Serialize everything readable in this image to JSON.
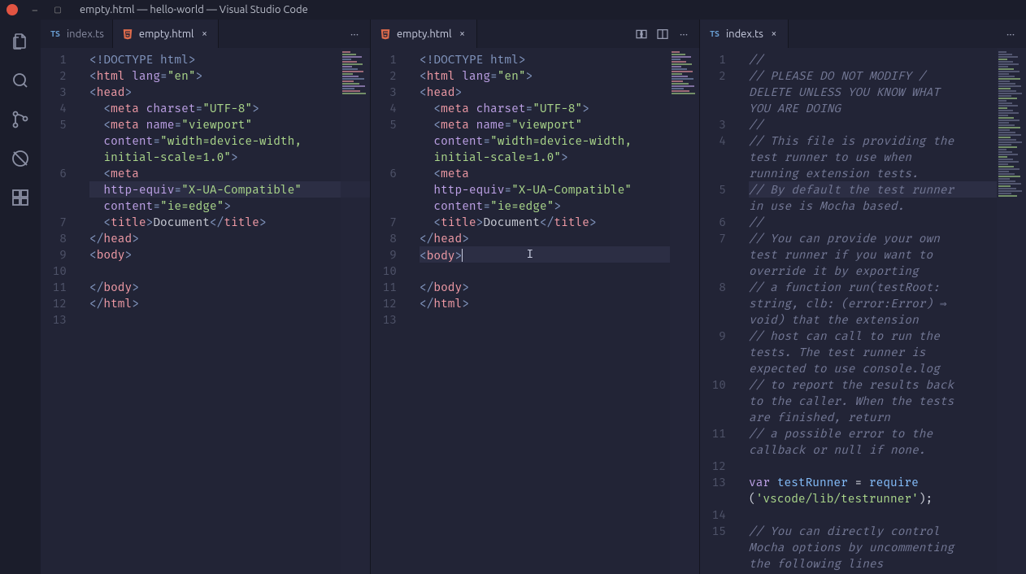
{
  "titlebar": {
    "title": "empty.html — hello-world — Visual Studio Code"
  },
  "activity": {
    "items": [
      "explorer",
      "search",
      "scm",
      "debug",
      "extensions"
    ]
  },
  "groups": [
    {
      "tabs": [
        {
          "label": "index.ts",
          "type": "ts",
          "active": false,
          "close": false
        },
        {
          "label": "empty.html",
          "type": "html",
          "active": true,
          "close": true
        }
      ],
      "actions": [
        "more"
      ],
      "lines": 13,
      "code": "html",
      "highlight_line": 6,
      "highlight_sub": true
    },
    {
      "tabs": [
        {
          "label": "empty.html",
          "type": "html",
          "active": true,
          "close": true
        }
      ],
      "actions": [
        "compare",
        "split",
        "more"
      ],
      "lines": 13,
      "code": "html",
      "cursor_line": 9,
      "highlight_line": 9
    },
    {
      "tabs": [
        {
          "label": "index.ts",
          "type": "ts",
          "active": true,
          "close": true
        }
      ],
      "actions": [
        "more"
      ],
      "lines": 15,
      "code": "ts",
      "highlight_line": 5
    }
  ],
  "html_code": {
    "1": [
      [
        "doct",
        "<!DOCTYPE html>"
      ]
    ],
    "2": [
      [
        "tg",
        "<"
      ],
      [
        "tagn",
        "html"
      ],
      [
        "txt",
        " "
      ],
      [
        "attr",
        "lang"
      ],
      [
        "tg",
        "="
      ],
      [
        "str",
        "\"en\""
      ],
      [
        "tg",
        ">"
      ]
    ],
    "3": [
      [
        "tg",
        "<"
      ],
      [
        "tagn",
        "head"
      ],
      [
        "tg",
        ">"
      ]
    ],
    "4": [
      [
        "txt",
        "  "
      ],
      [
        "tg",
        "<"
      ],
      [
        "tagn",
        "meta"
      ],
      [
        "txt",
        " "
      ],
      [
        "attr",
        "charset"
      ],
      [
        "tg",
        "="
      ],
      [
        "str",
        "\"UTF-8\""
      ],
      [
        "tg",
        ">"
      ]
    ],
    "5": [
      [
        "txt",
        "  "
      ],
      [
        "tg",
        "<"
      ],
      [
        "tagn",
        "meta"
      ],
      [
        "txt",
        " "
      ],
      [
        "attr",
        "name"
      ],
      [
        "tg",
        "="
      ],
      [
        "str",
        "\"viewport\""
      ]
    ],
    "5b": [
      [
        "txt",
        "  "
      ],
      [
        "attr",
        "content"
      ],
      [
        "tg",
        "="
      ],
      [
        "str",
        "\"width=device-width,"
      ]
    ],
    "5c": [
      [
        "txt",
        "  "
      ],
      [
        "str",
        "initial-scale=1.0\""
      ],
      [
        "tg",
        ">"
      ]
    ],
    "6": [
      [
        "txt",
        "  "
      ],
      [
        "tg",
        "<"
      ],
      [
        "tagn",
        "meta"
      ]
    ],
    "6b": [
      [
        "txt",
        "  "
      ],
      [
        "attr",
        "http-equiv"
      ],
      [
        "tg",
        "="
      ],
      [
        "str",
        "\"X-UA-Compatible\""
      ]
    ],
    "6c": [
      [
        "txt",
        "  "
      ],
      [
        "attr",
        "content"
      ],
      [
        "tg",
        "="
      ],
      [
        "str",
        "\"ie=edge\""
      ],
      [
        "tg",
        ">"
      ]
    ],
    "7": [
      [
        "txt",
        "  "
      ],
      [
        "tg",
        "<"
      ],
      [
        "tagn",
        "title"
      ],
      [
        "tg",
        ">"
      ],
      [
        "txt",
        "Document"
      ],
      [
        "tg",
        "</"
      ],
      [
        "tagn",
        "title"
      ],
      [
        "tg",
        ">"
      ]
    ],
    "8": [
      [
        "tg",
        "</"
      ],
      [
        "tagn",
        "head"
      ],
      [
        "tg",
        ">"
      ]
    ],
    "9": [
      [
        "tg",
        "<"
      ],
      [
        "tagn",
        "body"
      ],
      [
        "tg",
        ">"
      ]
    ],
    "10": [],
    "11": [
      [
        "tg",
        "</"
      ],
      [
        "tagn",
        "body"
      ],
      [
        "tg",
        ">"
      ]
    ],
    "12": [
      [
        "tg",
        "</"
      ],
      [
        "tagn",
        "html"
      ],
      [
        "tg",
        ">"
      ]
    ],
    "13": []
  },
  "ts_code": {
    "1": [
      [
        "cmt",
        "//"
      ]
    ],
    "2a": [
      [
        "cmt",
        "// PLEASE DO NOT MODIFY /"
      ]
    ],
    "2b": [
      [
        "cmt",
        "DELETE UNLESS YOU KNOW WHAT"
      ]
    ],
    "2c": [
      [
        "cmt",
        "YOU ARE DOING"
      ]
    ],
    "3": [
      [
        "cmt",
        "//"
      ]
    ],
    "4a": [
      [
        "cmt",
        "// This file is providing the"
      ]
    ],
    "4b": [
      [
        "cmt",
        "test runner to use when"
      ]
    ],
    "4c": [
      [
        "cmt",
        "running extension tests."
      ]
    ],
    "5a": [
      [
        "cmt",
        "// By default the test runner"
      ]
    ],
    "5b": [
      [
        "cmt",
        "in use is Mocha based."
      ]
    ],
    "6": [
      [
        "cmt",
        "//"
      ]
    ],
    "7a": [
      [
        "cmt",
        "// You can provide your own"
      ]
    ],
    "7b": [
      [
        "cmt",
        "test runner if you want to"
      ]
    ],
    "7c": [
      [
        "cmt",
        "override it by exporting"
      ]
    ],
    "8a": [
      [
        "cmt",
        "// a function run(testRoot:"
      ]
    ],
    "8b": [
      [
        "cmt",
        "string, clb: (error:Error) ⇒"
      ]
    ],
    "8c": [
      [
        "cmt",
        "void) that the extension"
      ]
    ],
    "9a": [
      [
        "cmt",
        "// host can call to run the"
      ]
    ],
    "9b": [
      [
        "cmt",
        "tests. The test runner is"
      ]
    ],
    "9c": [
      [
        "cmt",
        "expected to use console.log"
      ]
    ],
    "10a": [
      [
        "cmt",
        "// to report the results back"
      ]
    ],
    "10b": [
      [
        "cmt",
        "to the caller. When the tests"
      ]
    ],
    "10c": [
      [
        "cmt",
        "are finished, return"
      ]
    ],
    "11a": [
      [
        "cmt",
        "// a possible error to the"
      ]
    ],
    "11b": [
      [
        "cmt",
        "callback or null if none."
      ]
    ],
    "12": [],
    "13a": [
      [
        "kw",
        "var"
      ],
      [
        "txt",
        " "
      ],
      [
        "fn",
        "testRunner"
      ],
      [
        "txt",
        " = "
      ],
      [
        "fn",
        "require"
      ]
    ],
    "13b": [
      [
        "txt",
        "("
      ],
      [
        "str",
        "'vscode/lib/testrunner'"
      ],
      [
        "txt",
        ");"
      ]
    ],
    "14": [],
    "15a": [
      [
        "cmt",
        "// You can directly control"
      ]
    ],
    "15b": [
      [
        "cmt",
        "Mocha options by uncommenting"
      ]
    ],
    "15c": [
      [
        "cmt",
        "the following lines"
      ]
    ]
  },
  "html_line_map": [
    "1",
    "2",
    "3",
    "4",
    "5",
    "5b",
    "5c",
    "6",
    "6b",
    "6c",
    "7",
    "8",
    "9",
    "10",
    "11",
    "12",
    "13"
  ],
  "html_line_nums": [
    1,
    2,
    3,
    4,
    5,
    "",
    "",
    6,
    "",
    "",
    7,
    8,
    9,
    10,
    11,
    12,
    13
  ],
  "ts_line_map": [
    "1",
    "2a",
    "2b",
    "2c",
    "3",
    "4a",
    "4b",
    "4c",
    "5a",
    "5b",
    "6",
    "7a",
    "7b",
    "7c",
    "8a",
    "8b",
    "8c",
    "9a",
    "9b",
    "9c",
    "10a",
    "10b",
    "10c",
    "11a",
    "11b",
    "12",
    "13a",
    "13b",
    "14",
    "15a",
    "15b",
    "15c"
  ],
  "ts_line_nums": [
    1,
    2,
    "",
    "",
    3,
    4,
    "",
    "",
    5,
    "",
    6,
    7,
    "",
    "",
    8,
    "",
    "",
    9,
    "",
    "",
    10,
    "",
    "",
    11,
    "",
    12,
    13,
    "",
    14,
    15,
    "",
    ""
  ]
}
